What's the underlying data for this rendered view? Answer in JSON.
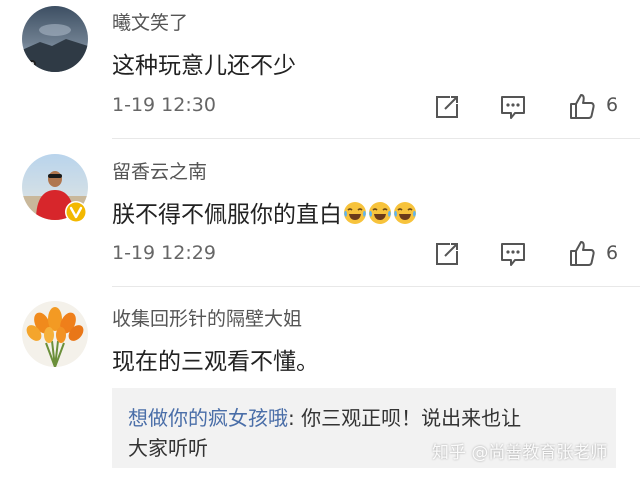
{
  "colors": {
    "reply_author": "#4a6ea8",
    "text_primary": "#222222",
    "text_secondary": "#555555",
    "verified_badge": "#f3b800",
    "reply_bg": "#f2f2f2"
  },
  "comments": [
    {
      "username": "曦文笑了",
      "text": "这种玩意儿还不少",
      "time": "1-19 12:30",
      "likes": "6",
      "icons": [
        "share-icon",
        "comment-icon",
        "thumbs-up-icon"
      ]
    },
    {
      "username": "留香云之南",
      "text": "朕不得不佩服你的直白",
      "emoji": [
        "laugh-cry-emoji",
        "laugh-cry-emoji",
        "laugh-cry-emoji"
      ],
      "time": "1-19 12:29",
      "likes": "6",
      "verified": true,
      "icons": [
        "share-icon",
        "comment-icon",
        "thumbs-up-icon"
      ]
    },
    {
      "username": "收集回形针的隔壁大姐",
      "text": "现在的三观看不懂。",
      "reply": {
        "author": "想做你的疯女孩哦",
        "separator": ": ",
        "line1": "你三观正呗！说出来也让",
        "line2": "大家听听"
      }
    }
  ],
  "watermark": "知乎 @尚善教育张老师"
}
